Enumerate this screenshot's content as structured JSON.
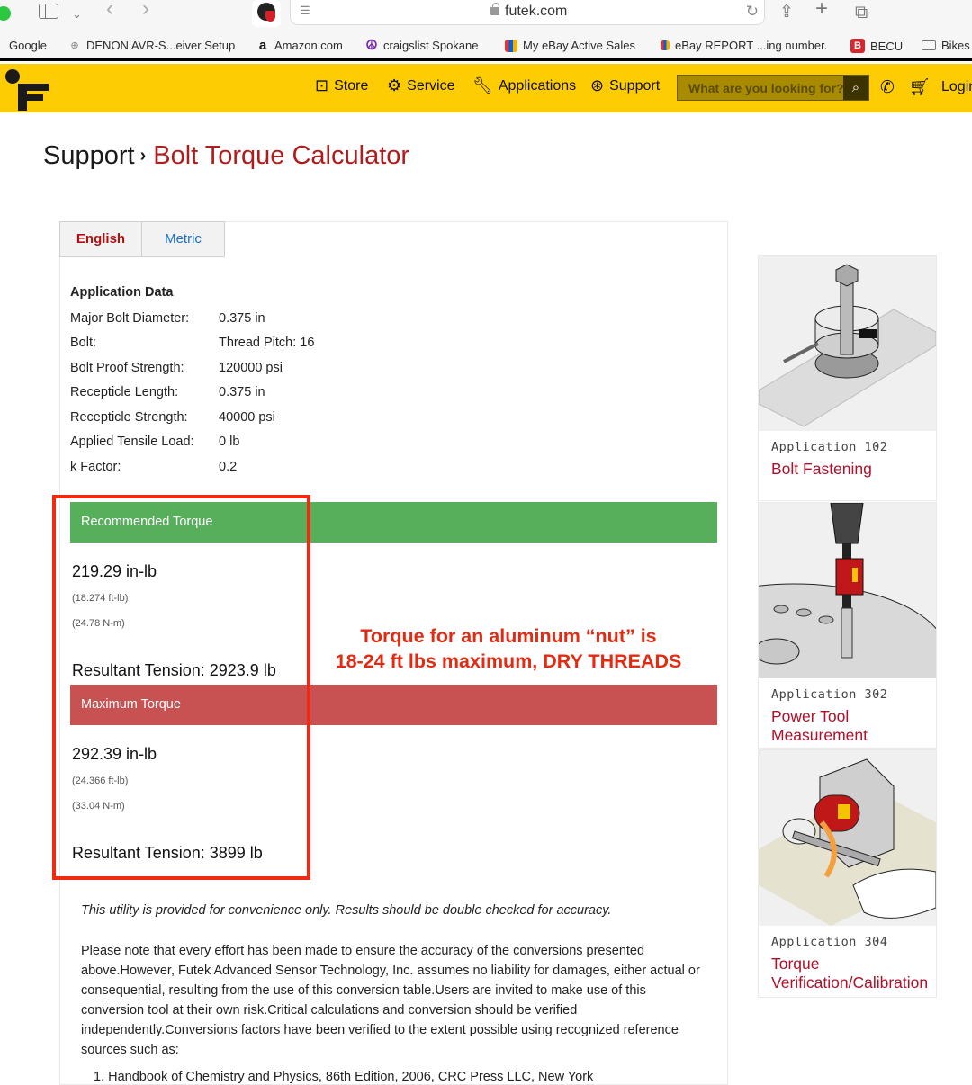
{
  "browser": {
    "url": "futek.com",
    "bookmarks": [
      {
        "label": "Google",
        "icon": "google-icon"
      },
      {
        "label": "DENON AVR-S...eiver Setup",
        "icon": "globe-icon"
      },
      {
        "label": "Amazon.com",
        "icon": "amazon-icon"
      },
      {
        "label": "craigslist Spokane",
        "icon": "peace-icon"
      },
      {
        "label": "My eBay Active Sales",
        "icon": "ebay-bag-icon"
      },
      {
        "label": "eBay REPORT ...ing number.",
        "icon": "ebay-bag-icon"
      },
      {
        "label": "BECU",
        "icon": "becu-icon"
      },
      {
        "label": "Bikes",
        "icon": "folder-icon"
      }
    ]
  },
  "header": {
    "nav": [
      {
        "label": "Store",
        "icon": "store-icon"
      },
      {
        "label": "Service",
        "icon": "gear-icon"
      },
      {
        "label": "Applications",
        "icon": "wrench-icon"
      },
      {
        "label": "Support",
        "icon": "lifebuoy-icon"
      }
    ],
    "search_placeholder": "What are you looking for?",
    "login": "Login",
    "brand_color": "#fecc02"
  },
  "breadcrumb": {
    "parent": "Support",
    "current": "Bolt Torque Calculator"
  },
  "tabs": [
    {
      "label": "English",
      "active": true
    },
    {
      "label": "Metric",
      "active": false
    }
  ],
  "application_data": {
    "title": "Application Data",
    "rows": [
      {
        "label": "Major Bolt Diameter:",
        "value": "0.375 in"
      },
      {
        "label": "Bolt:",
        "value": "Thread Pitch: 16"
      },
      {
        "label": "Bolt Proof Strength:",
        "value": "120000 psi"
      },
      {
        "label": "Recepticle Length:",
        "value": "0.375 in"
      },
      {
        "label": "Recepticle Strength:",
        "value": "40000 psi"
      },
      {
        "label": "Applied Tensile Load:",
        "value": "0 lb"
      },
      {
        "label": "k Factor:",
        "value": "0.2"
      }
    ]
  },
  "recommended": {
    "title": "Recommended Torque",
    "value": "219.29 in-lb",
    "ftlb": "(18.274 ft-lb)",
    "nm": "(24.78 N-m)",
    "tension": "Resultant Tension: 2923.9 lb",
    "color": "#57ae5b"
  },
  "maximum": {
    "title": "Maximum Torque",
    "value": "292.39 in-lb",
    "ftlb": "(24.366 ft-lb)",
    "nm": "(33.04 N-m)",
    "tension": "Resultant Tension: 3899 lb",
    "color": "#c85252"
  },
  "annotation": {
    "line1": "Torque for an aluminum “nut” is",
    "line2": "18-24 ft lbs maximum, DRY THREADS"
  },
  "disclaimer": {
    "italic": "This utility is provided for convenience only.  Results should be double checked for accuracy.",
    "body": "Please note that every effort has been made to ensure the accuracy of the conversions presented above.However, Futek Advanced Sensor Technology, Inc. assumes no liability for damages, either actual or consequential, resulting from the use of this conversion table.Users are invited to make use of this conversion tool at their own risk.Critical calculations and conversion should be verified independently.Conversions factors have been verified to the extent possible using recognized reference sources such as:",
    "ref1": "1.  Handbook of Chemistry and Physics, 86th Edition, 2006, CRC Press LLC, New York"
  },
  "applications": [
    {
      "number": "Application 102",
      "title": "Bolt Fastening"
    },
    {
      "number": "Application 302",
      "title": "Power Tool Measurement"
    },
    {
      "number": "Application 304",
      "title": "Torque Verification/Calibration"
    }
  ]
}
